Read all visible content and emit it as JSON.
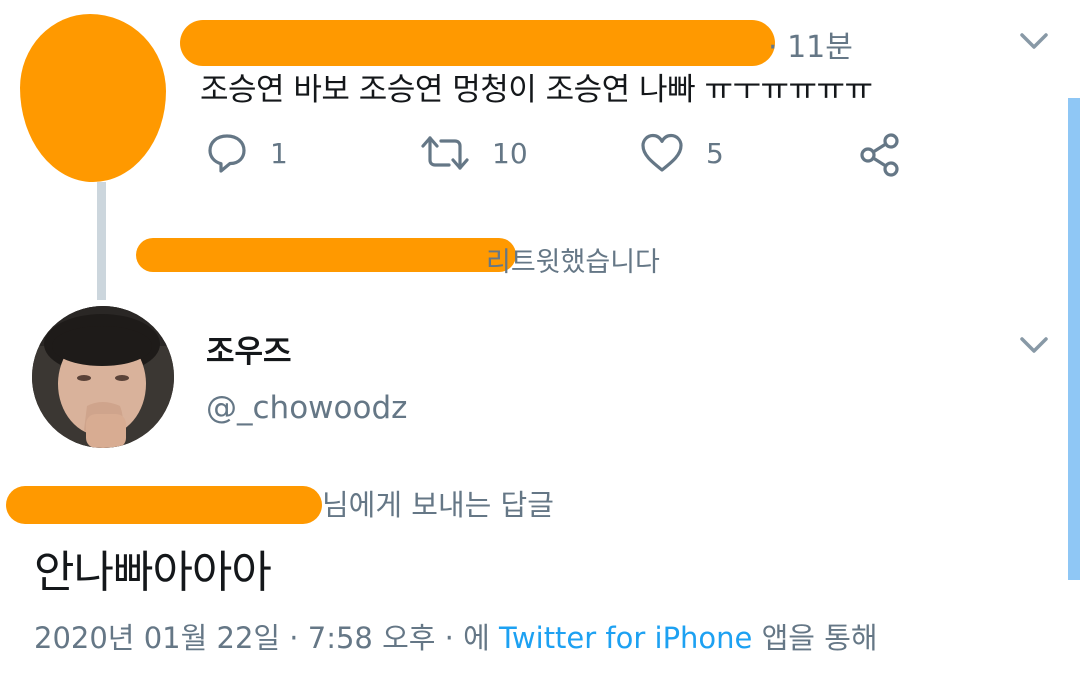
{
  "tweet": {
    "time": "· 11분",
    "text": "조승연 바보 조승연 멍청이 조승연 나빠 ㅠㅜㅠㅠㅠㅠ",
    "actions": {
      "reply_count": "1",
      "retweet_count": "10",
      "like_count": "5"
    }
  },
  "retweet_notice": {
    "suffix": "리트윗했습니다"
  },
  "reply_tweet": {
    "name": "조우즈",
    "handle": "@_chowoodz",
    "reply_to_suffix": "님에게 보내는 답글",
    "text": "안나빠아아아",
    "meta": {
      "date_time": "2020년 01월 22일 · 7:58 오후 · 에 ",
      "source": "Twitter for iPhone",
      "source_suffix": " 앱을 통해"
    }
  },
  "colors": {
    "redaction": "#ff9900",
    "link": "#1da1f2",
    "muted": "#657786",
    "text": "#14171a"
  },
  "icons": [
    "reply-icon",
    "retweet-icon",
    "like-icon",
    "share-icon",
    "chevron-down-icon"
  ]
}
